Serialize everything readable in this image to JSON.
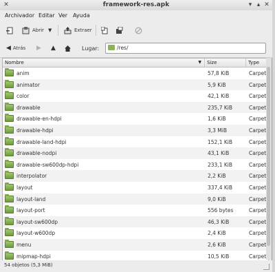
{
  "window": {
    "title": "framework-res.apk",
    "controls": [
      "minimize-icon",
      "maximize-icon",
      "close-icon"
    ]
  },
  "menu": {
    "items": [
      "Archivador",
      "Editar",
      "Ver",
      "Ayuda"
    ]
  },
  "toolbar": {
    "open_label": "Abrir",
    "extract_label": "Extraer",
    "icons": [
      "new-archive-icon",
      "open-archive-icon",
      "dropdown-arrow-icon",
      "extract-icon",
      "add-files-icon",
      "add-folder-icon",
      "stop-icon"
    ]
  },
  "location": {
    "back_label": "Atrás",
    "location_label": "Lugar:",
    "path": "/res/"
  },
  "columns": {
    "name": "Nombre",
    "size": "Size",
    "type": "Type"
  },
  "files": [
    {
      "name": "anim",
      "size": "57,8 KiB",
      "type": "Carpeta"
    },
    {
      "name": "animator",
      "size": "5,9 KiB",
      "type": "Carpeta"
    },
    {
      "name": "color",
      "size": "42,1 KiB",
      "type": "Carpeta"
    },
    {
      "name": "drawable",
      "size": "235,7 KiB",
      "type": "Carpeta"
    },
    {
      "name": "drawable-en-hdpi",
      "size": "1,6 KiB",
      "type": "Carpeta"
    },
    {
      "name": "drawable-hdpi",
      "size": "3,3 MiB",
      "type": "Carpeta"
    },
    {
      "name": "drawable-land-hdpi",
      "size": "152,1 KiB",
      "type": "Carpeta"
    },
    {
      "name": "drawable-nodpi",
      "size": "43,1 KiB",
      "type": "Carpeta"
    },
    {
      "name": "drawable-sw600dp-hdpi",
      "size": "233,1 KiB",
      "type": "Carpeta"
    },
    {
      "name": "interpolator",
      "size": "2,2 KiB",
      "type": "Carpeta"
    },
    {
      "name": "layout",
      "size": "337,4 KiB",
      "type": "Carpeta"
    },
    {
      "name": "layout-land",
      "size": "9,0 KiB",
      "type": "Carpeta"
    },
    {
      "name": "layout-port",
      "size": "556 bytes",
      "type": "Carpeta"
    },
    {
      "name": "layout-sw600dp",
      "size": "46,3 KiB",
      "type": "Carpeta"
    },
    {
      "name": "layout-w600dp",
      "size": "2,4 KiB",
      "type": "Carpeta"
    },
    {
      "name": "menu",
      "size": "2,6 KiB",
      "type": "Carpeta"
    },
    {
      "name": "mipmap-hdpi",
      "size": "10,5 KiB",
      "type": "Carpeta"
    }
  ],
  "status": {
    "text": "54 objetos (5,3 MiB)"
  },
  "colors": {
    "folder": "#7ea84a",
    "window_bg": "#e8e8e8"
  }
}
